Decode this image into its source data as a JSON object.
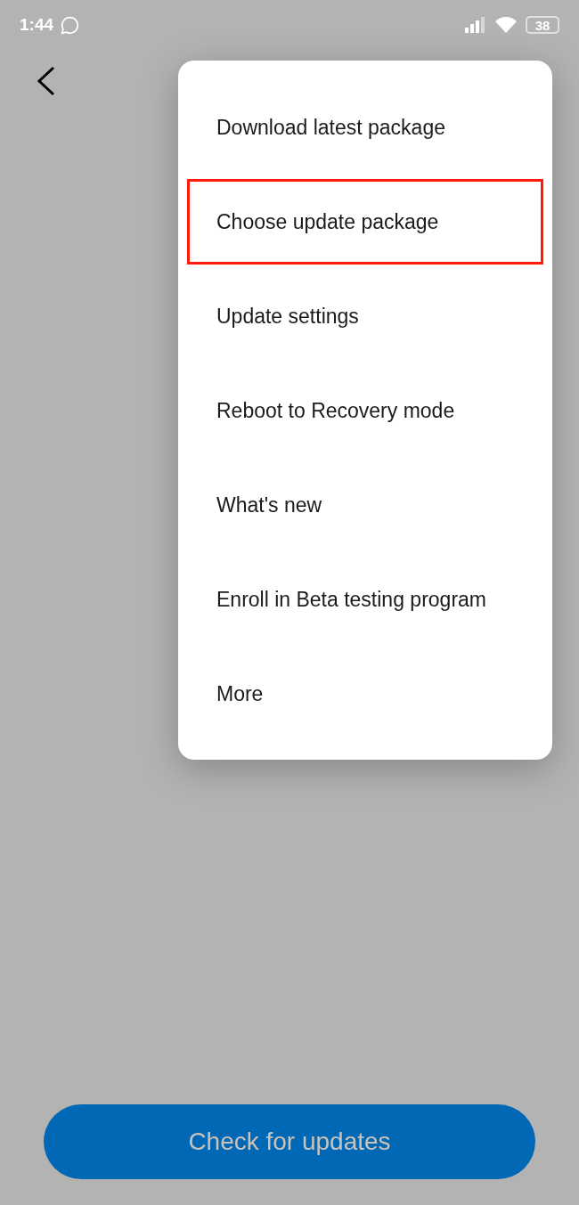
{
  "status_bar": {
    "time": "1:44",
    "battery": "38"
  },
  "menu": {
    "items": [
      {
        "label": "Download latest package",
        "highlighted": false
      },
      {
        "label": "Choose update package",
        "highlighted": true
      },
      {
        "label": "Update settings",
        "highlighted": false
      },
      {
        "label": "Reboot to Recovery mode",
        "highlighted": false
      },
      {
        "label": "What's new",
        "highlighted": false
      },
      {
        "label": "Enroll in Beta testing program",
        "highlighted": false
      },
      {
        "label": "More",
        "highlighted": false
      }
    ]
  },
  "check_button": {
    "label": "Check for updates"
  }
}
